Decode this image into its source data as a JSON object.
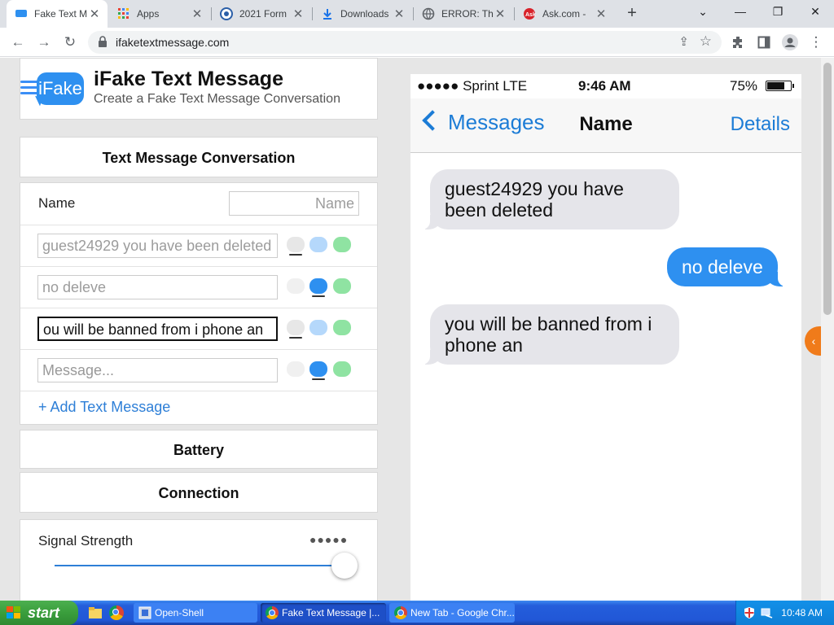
{
  "browser": {
    "tabs": [
      {
        "title": "Fake Text M",
        "icon": "chat-bubble-icon",
        "active": true
      },
      {
        "title": "Apps",
        "icon": "apps-grid-icon",
        "active": false
      },
      {
        "title": "2021 Form",
        "icon": "seal-icon",
        "active": false
      },
      {
        "title": "Downloads",
        "icon": "download-icon",
        "active": false
      },
      {
        "title": "ERROR: The",
        "icon": "globe-icon",
        "active": false
      },
      {
        "title": "Ask.com - ",
        "icon": "ask-icon",
        "active": false
      }
    ],
    "url": "ifaketextmessage.com"
  },
  "app": {
    "logo_text": "iFake",
    "title": "iFake Text Message",
    "subtitle": "Create a Fake Text Message Conversation"
  },
  "form": {
    "section_title": "Text Message Conversation",
    "name_label": "Name",
    "name_placeholder": "Name",
    "messages": [
      {
        "text": "guest24929 you have been deleted",
        "style": "gray"
      },
      {
        "text": "no deleve",
        "style": "blue"
      },
      {
        "text": "ou will be banned from i phone an",
        "style": "gray"
      }
    ],
    "message_placeholder": "Message...",
    "add_label": "+ Add Text Message",
    "battery_section": "Battery",
    "connection_section": "Connection",
    "signal_label": "Signal Strength",
    "signal_dots": "●●●●●",
    "signal_level": 1.0
  },
  "phone": {
    "carrier": "●●●●● Sprint  LTE",
    "time": "9:46 AM",
    "battery_pct": "75%",
    "battery_level": 0.75,
    "back_label": "Messages",
    "contact_name": "Name",
    "details_label": "Details",
    "bubbles": [
      {
        "text": "guest24929 you have been deleted",
        "direction": "received"
      },
      {
        "text": "no deleve",
        "direction": "sent"
      },
      {
        "text": "you will be banned from i phone an",
        "direction": "received"
      }
    ]
  },
  "taskbar": {
    "start_label": "start",
    "tasks": [
      {
        "label": "Open-Shell",
        "active": false
      },
      {
        "label": "Fake Text Message |...",
        "active": true
      },
      {
        "label": "New Tab - Google Chr...",
        "active": false
      }
    ],
    "clock": "10:48 AM"
  },
  "colors": {
    "accent_blue": "#2e90f0",
    "link_blue": "#1c7cd6",
    "green_bubble": "#8fe3a2",
    "received_bubble": "#e5e5ea",
    "side_tab_orange": "#f07b1a"
  }
}
